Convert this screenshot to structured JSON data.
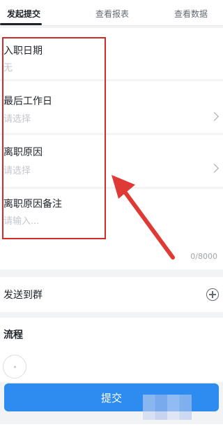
{
  "tabs": [
    {
      "label": "发起提交",
      "active": true
    },
    {
      "label": "查看报表",
      "active": false
    },
    {
      "label": "查看数据",
      "active": false
    }
  ],
  "form": {
    "fields": [
      {
        "label": "入职日期",
        "value": "无"
      },
      {
        "label": "最后工作日",
        "placeholder": "请选择"
      },
      {
        "label": "离职原因",
        "placeholder": "请选择"
      },
      {
        "label": "离职原因备注",
        "placeholder": "请输入...",
        "counter": "0/8000"
      }
    ]
  },
  "send_to_group": {
    "label": "发送到群"
  },
  "flow": {
    "title": "流程"
  },
  "submit": {
    "label": "提交"
  },
  "colors": {
    "accent": "#2e8bf0",
    "highlight": "#d12b2b"
  },
  "icons": {
    "chevron": "chevron-right-icon",
    "add": "add-circle-icon",
    "arrow": "red-annotation-arrow"
  }
}
